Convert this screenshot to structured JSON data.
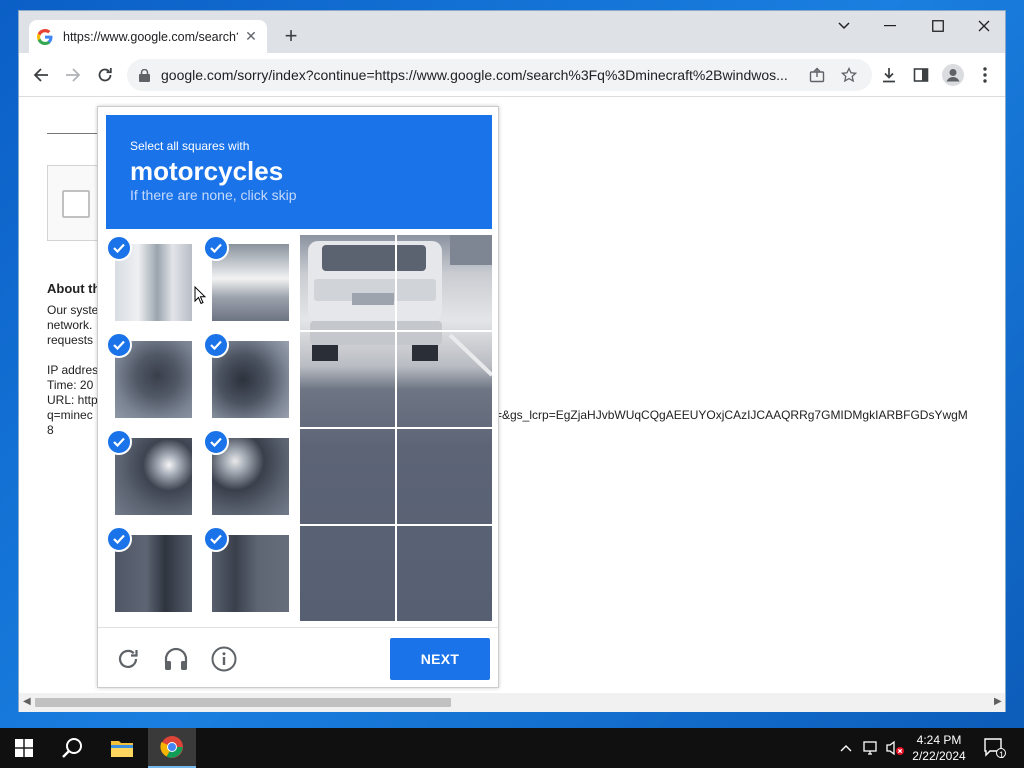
{
  "browser": {
    "tab_title": "https://www.google.com/search?",
    "url": "google.com/sorry/index?continue=https://www.google.com/search%3Fq%3Dminecraft%2Bwindwos..."
  },
  "page": {
    "about_heading": "About th",
    "para1_line1": "Our syste",
    "para1_line2": "network.",
    "para1_line3": "requests",
    "ip_label": "IP addres",
    "time_label": "Time: 20",
    "url_label": "URL: http",
    "url_line2": "q=minec",
    "url_tail": "=&gs_lcrp=EgZjaHJvbWUqCQgAEEUYOxjCAzIJCAAQRRg7GMIDMgkIARBFGDsYwgM",
    "url_line3": "8"
  },
  "captcha": {
    "sub": "Select all squares with",
    "target": "motorcycles",
    "hint": "If there are none, click skip",
    "next_label": "NEXT",
    "selected_tiles": 8
  },
  "taskbar": {
    "time": "4:24 PM",
    "date": "2/22/2024",
    "notification_count": "1"
  },
  "colors": {
    "captcha_blue": "#1a73e8",
    "desktop_blue": "#0b5fc6"
  }
}
